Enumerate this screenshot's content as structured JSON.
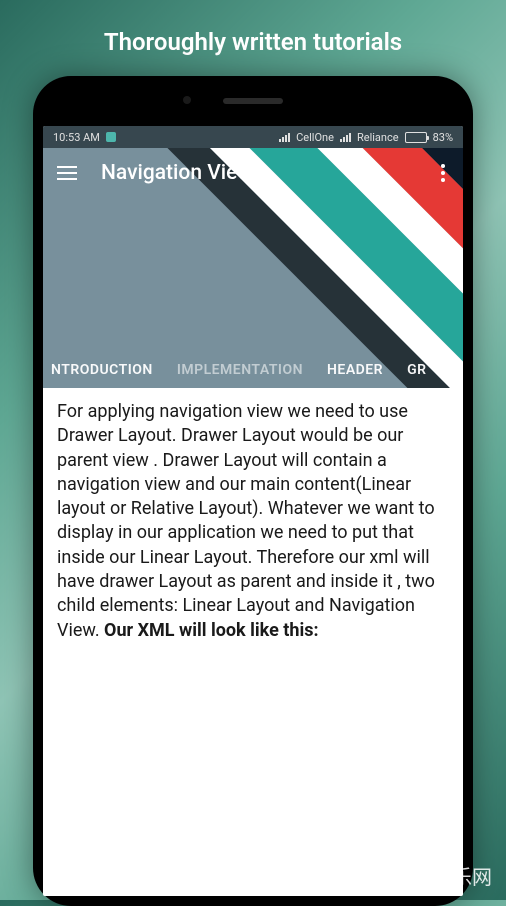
{
  "promo": {
    "title": "Thoroughly written tutorials"
  },
  "statusBar": {
    "time": "10:53 AM",
    "carrier1": "CellOne",
    "carrier2": "Reliance",
    "battery": "83%"
  },
  "appBar": {
    "title": "Navigation View"
  },
  "tabs": [
    {
      "label": "NTRODUCTION",
      "active": true
    },
    {
      "label": "IMPLEMENTATION",
      "active": false
    },
    {
      "label": "HEADER",
      "active": true
    },
    {
      "label": "GR",
      "active": true
    }
  ],
  "content": {
    "body": " For applying navigation view we need to use Drawer Layout. Drawer Layout would be our parent view . Drawer Layout will contain a navigation view and our main content(Linear layout or Relative Layout). Whatever we want to display in our application we need to put that inside our Linear Layout. Therefore our xml will have drawer Layout as parent and inside it , two child elements: Linear Layout and Navigation View. ",
    "boldPart": "Our XML will look like this:"
  },
  "watermark": {
    "text": "d.cn 当乐网"
  }
}
